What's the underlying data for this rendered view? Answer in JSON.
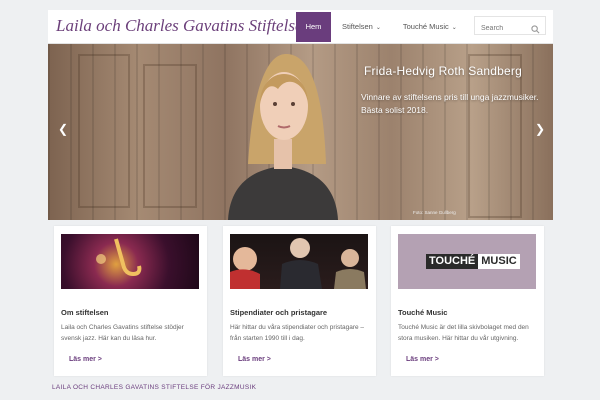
{
  "header": {
    "site_title": "Laila och Charles Gavatins Stiftelse",
    "nav": [
      {
        "label": "Hem"
      },
      {
        "label": "Stiftelsen"
      },
      {
        "label": "Touché Music"
      }
    ],
    "search_placeholder": "Search"
  },
  "hero": {
    "title": "Frida-Hedvig Roth Sandberg",
    "subtitle": "Vinnare av stiftelsens pris till unga jazzmusiker. Bästa solist 2018.",
    "credit": "Foto: Sanne Gullberg"
  },
  "cards": [
    {
      "title": "Om stiftelsen",
      "text": "Laila och Charles Gavatins stiftelse stödjer svensk jazz. Här kan du läsa hur.",
      "link": "Läs mer >"
    },
    {
      "title": "Stipendiater och pristagare",
      "text": "Här hittar du våra stipendiater och pristagare – från starten 1990 till i dag.",
      "link": "Läs mer >"
    },
    {
      "title": "Touché Music",
      "text": "Touché Music är det lilla skivbolaget med den stora musiken. Här hittar du vår utgivning.",
      "link": "Läs mer >",
      "logo_left": "TOUCHÉ",
      "logo_right": "MUSIC"
    }
  ],
  "footer": {
    "title": "LAILA OCH CHARLES GAVATINS STIFTELSE FÖR JAZZMUSIK"
  },
  "colors": {
    "accent": "#6a3d7d",
    "title": "#6b3f7a"
  },
  "icons": [
    "search-icon",
    "chevron-down-icon",
    "chevron-left-icon",
    "chevron-right-icon"
  ]
}
